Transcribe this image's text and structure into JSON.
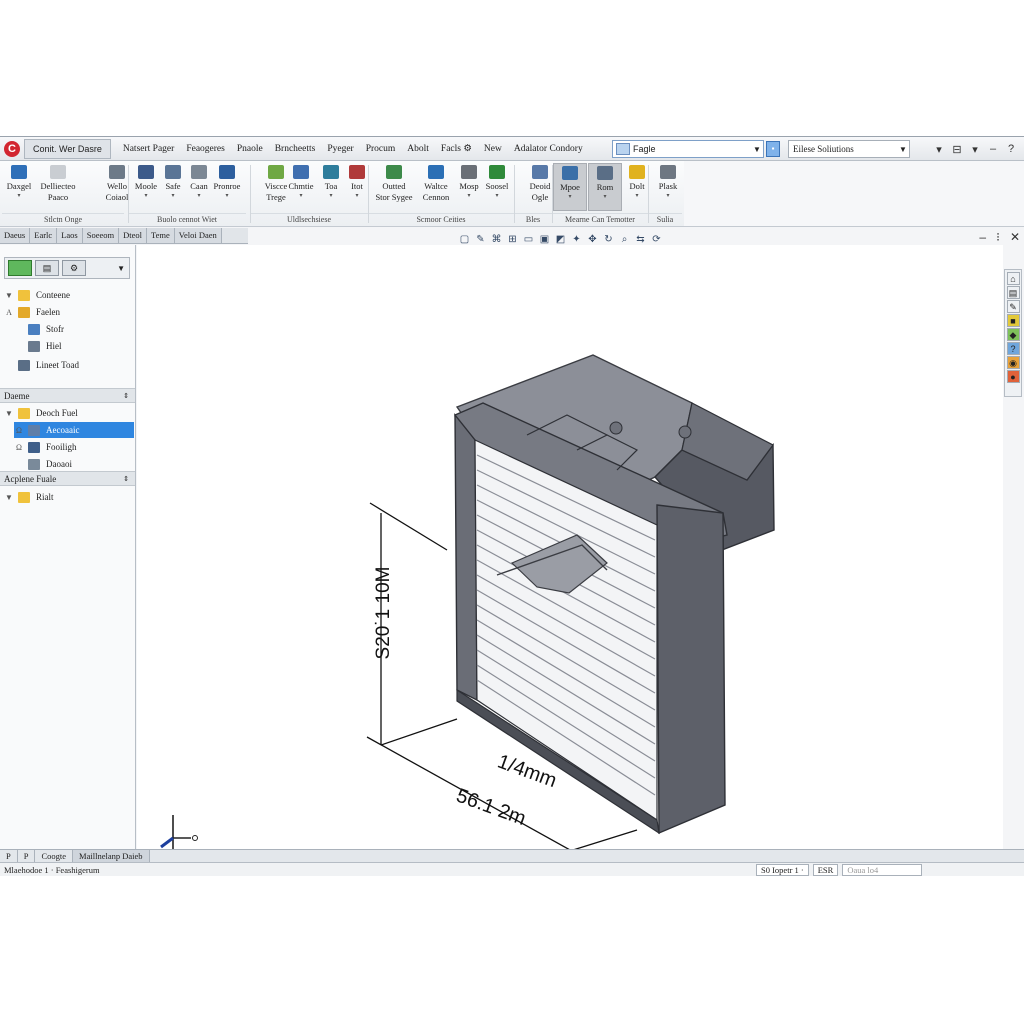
{
  "menubar": {
    "logo_letter": "C",
    "doc_tab": "Conit. Wer Dasre",
    "items": [
      "Natsert Pager",
      "Feaogeres",
      "Pnaole",
      "Brncheetts",
      "Pyeger",
      "Procum",
      "Abolt",
      "Facls ⚙",
      "New",
      "Adalator Condory"
    ],
    "search_text": "Fagle",
    "solutions_text": "Eilese Soliutions"
  },
  "ribbon": {
    "buttons": [
      {
        "label": "Daxgel",
        "color": "#2e6fb8"
      },
      {
        "label": "Delliecteo",
        "label2": "Paaco",
        "color": "#c9cdd2"
      },
      {
        "label": "Wello",
        "label2": "Coiaol",
        "color": "#6d7a88"
      },
      {
        "label": "Moole",
        "color": "#3c5a8a"
      },
      {
        "label": "Safe",
        "color": "#5a7596"
      },
      {
        "label": "Caan",
        "color": "#7b8794"
      },
      {
        "label": "Pronroe",
        "color": "#2d5f9e"
      },
      {
        "label": "Viscce",
        "label2": "Trege",
        "color": "#6fa844"
      },
      {
        "label": "Chmtie",
        "color": "#3f6fb0"
      },
      {
        "label": "Toa",
        "color": "#2e7d9c"
      },
      {
        "label": "Itot",
        "color": "#b03a3a"
      },
      {
        "label": "Outted",
        "label2": "Stor Sygee",
        "color": "#3d8a4a"
      },
      {
        "label": "Waltce",
        "label2": "Cennon",
        "color": "#2b6fb5"
      },
      {
        "label": "Mosp",
        "color": "#6a6f76"
      },
      {
        "label": "Soosel",
        "color": "#2f8a3a"
      },
      {
        "label": "Deoid",
        "label2": "Ogle",
        "color": "#5779a8"
      },
      {
        "label": "Mpoe",
        "color": "#3a6fa8"
      },
      {
        "label": "Rom",
        "color": "#5a6e86"
      },
      {
        "label": "Dolt",
        "color": "#e0b21f"
      },
      {
        "label": "Plask",
        "color": "#6e7782"
      }
    ],
    "groups": [
      "Stlctn Onge",
      "Buolo cennot Wiet",
      "Uldlsechsiese",
      "Scmoor Ceities",
      "Bles",
      "Mearne Can Temotter",
      "Sulia"
    ]
  },
  "fm_tabs": [
    "Daeus",
    "Earlc",
    "Laos",
    "Soeeom",
    "Dteol",
    "Teme",
    "Veloi Daen"
  ],
  "left_panel": {
    "tree_top": [
      {
        "label": "Conteene",
        "color": "#f0c23c",
        "twisty": "▼"
      },
      {
        "label": "Faelen",
        "color": "#e3a92a",
        "twisty": "A"
      },
      {
        "label": "Stofr",
        "color": "#4a7fc0",
        "twisty": ""
      },
      {
        "label": "Hiel",
        "color": "#6a7a8e",
        "twisty": ""
      }
    ],
    "item_lineet": "Lineet Toad",
    "section1": "Daeme",
    "tree_mid": [
      {
        "label": "Deoch Fuel",
        "color": "#f0c23c",
        "twisty": "▼"
      },
      {
        "label": "Aecoaaic",
        "color": "#5f7ea8",
        "twisty": "Ω",
        "selected": true
      },
      {
        "label": "Fooiligh",
        "color": "#3f5f8a",
        "twisty": "Ω"
      },
      {
        "label": "Daoaoi",
        "color": "#7a8a9a",
        "twisty": ""
      }
    ],
    "section2": "Acplene Fuale",
    "tree_bot": [
      {
        "label": "Rialt",
        "color": "#f0c23c",
        "twisty": "▼"
      }
    ]
  },
  "canvas": {
    "dim_vertical": "S20˙1 10M",
    "dim_horizontal": "56.1 2m",
    "dim_width": "1/4mm"
  },
  "bottom_tabs": [
    "P",
    "P",
    "Coogte",
    "Maillnelanp Daieb"
  ],
  "status": {
    "left": "Mlaehodoe 1 · Feashigerum",
    "page": "S0 Iopetr 1 ·",
    "field2": "ESR",
    "field3": "Oaua lo4"
  }
}
